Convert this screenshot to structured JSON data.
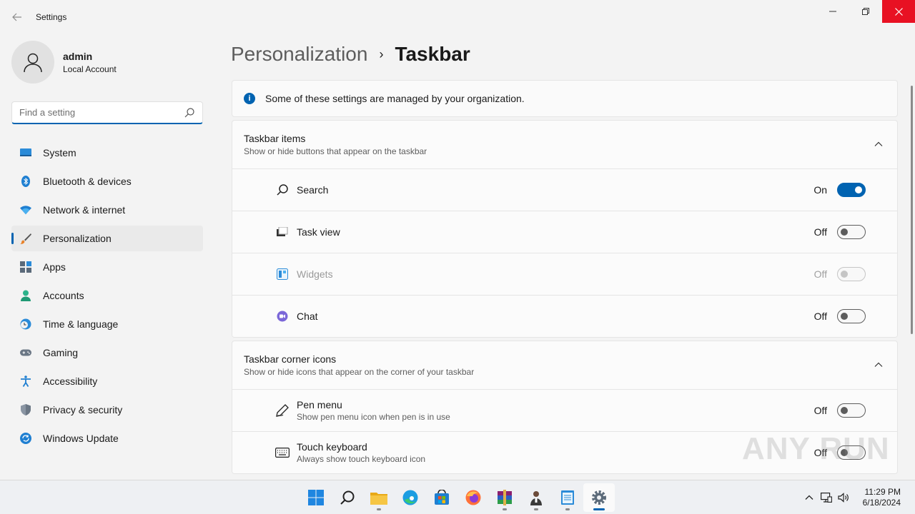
{
  "window": {
    "title": "Settings",
    "back_icon": "back-arrow-icon",
    "minimize_icon": "minimize-icon",
    "restore_icon": "restore-icon",
    "close_icon": "close-icon"
  },
  "profile": {
    "name": "admin",
    "account_type": "Local Account",
    "avatar_icon": "user-icon"
  },
  "search": {
    "placeholder": "Find a setting",
    "icon": "search-icon"
  },
  "sidebar": {
    "items": [
      {
        "label": "System",
        "icon": "system-icon",
        "active": false
      },
      {
        "label": "Bluetooth & devices",
        "icon": "bluetooth-icon",
        "active": false
      },
      {
        "label": "Network & internet",
        "icon": "wifi-icon",
        "active": false
      },
      {
        "label": "Personalization",
        "icon": "brush-icon",
        "active": true
      },
      {
        "label": "Apps",
        "icon": "apps-icon",
        "active": false
      },
      {
        "label": "Accounts",
        "icon": "accounts-icon",
        "active": false
      },
      {
        "label": "Time & language",
        "icon": "clock-globe-icon",
        "active": false
      },
      {
        "label": "Gaming",
        "icon": "gamepad-icon",
        "active": false
      },
      {
        "label": "Accessibility",
        "icon": "accessibility-icon",
        "active": false
      },
      {
        "label": "Privacy & security",
        "icon": "shield-icon",
        "active": false
      },
      {
        "label": "Windows Update",
        "icon": "update-icon",
        "active": false
      }
    ]
  },
  "breadcrumb": {
    "parent": "Personalization",
    "separator": "›",
    "current": "Taskbar"
  },
  "info_bar": {
    "text": "Some of these settings are managed by your organization.",
    "icon": "info-icon"
  },
  "taskbar_items": {
    "title": "Taskbar items",
    "subtitle": "Show or hide buttons that appear on the taskbar",
    "rows": [
      {
        "label": "Search",
        "state": "On",
        "on": true,
        "disabled": false,
        "icon": "search-icon"
      },
      {
        "label": "Task view",
        "state": "Off",
        "on": false,
        "disabled": false,
        "icon": "task-view-icon"
      },
      {
        "label": "Widgets",
        "state": "Off",
        "on": false,
        "disabled": true,
        "icon": "widgets-icon"
      },
      {
        "label": "Chat",
        "state": "Off",
        "on": false,
        "disabled": false,
        "icon": "chat-icon"
      }
    ]
  },
  "corner_icons": {
    "title": "Taskbar corner icons",
    "subtitle": "Show or hide icons that appear on the corner of your taskbar",
    "rows": [
      {
        "label": "Pen menu",
        "sub": "Show pen menu icon when pen is in use",
        "state": "Off",
        "on": false,
        "icon": "pen-icon"
      },
      {
        "label": "Touch keyboard",
        "sub": "Always show touch keyboard icon",
        "state": "Off",
        "on": false,
        "icon": "keyboard-icon"
      }
    ]
  },
  "watermark": "ANY RUN",
  "taskbar": {
    "apps": [
      "start-icon",
      "search-icon",
      "file-explorer-icon",
      "edge-icon",
      "store-icon",
      "firefox-icon",
      "winrar-icon",
      "user-app-icon",
      "notepad-icon",
      "settings-icon"
    ],
    "tray": [
      "chevron-up-icon",
      "network-icon",
      "volume-icon"
    ],
    "time": "11:29 PM",
    "date": "6/18/2024"
  },
  "colors": {
    "accent": "#0063b1",
    "close_button": "#e81123",
    "background": "#f3f3f3"
  }
}
